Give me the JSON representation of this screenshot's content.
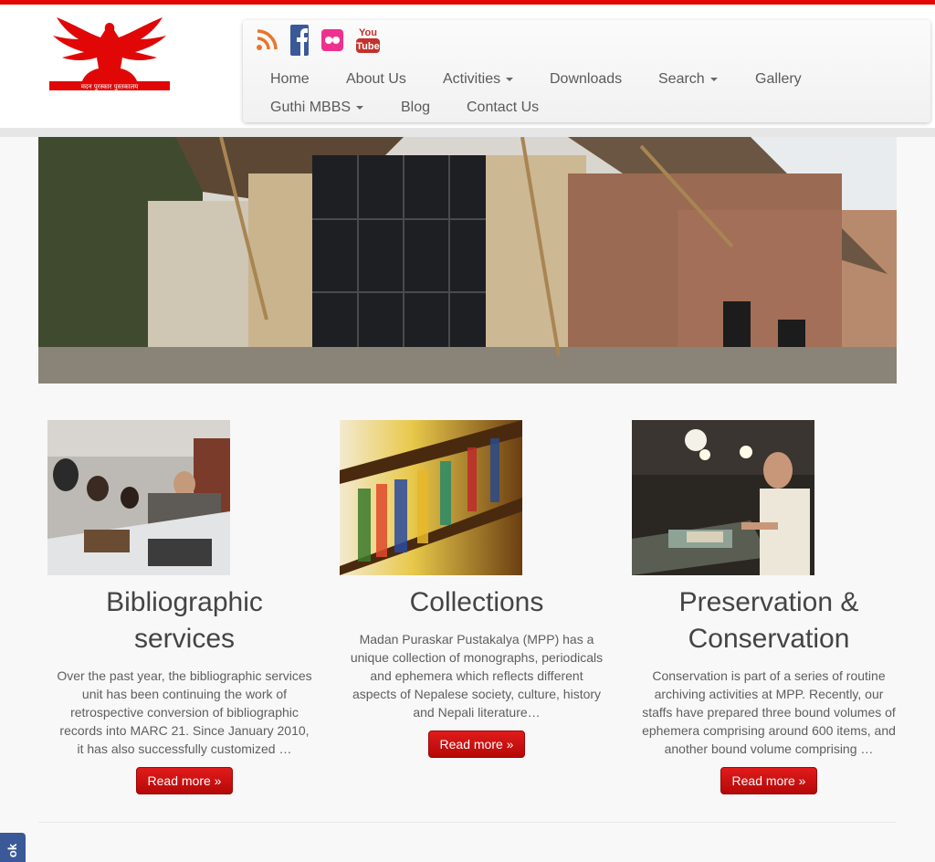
{
  "header": {
    "logo_caption": "मदन पुरस्कार पुस्तकालय"
  },
  "social": [
    "rss-icon",
    "facebook-icon",
    "flickr-icon",
    "youtube-icon"
  ],
  "social_labels": {
    "youtube_top": "You",
    "youtube_bottom": "Tube"
  },
  "nav": {
    "row1": [
      "Home",
      "About Us",
      "Activities",
      "Downloads",
      "Search",
      "Gallery"
    ],
    "row2": [
      "Guthi MBBS",
      "Blog",
      "Contact Us"
    ]
  },
  "cards": [
    {
      "title_line1": "Bibliographic",
      "title_line2": "services",
      "text": [
        "Over the past year, the bibliographic services",
        "unit has been continuing the work of",
        "retrospective conversion of bibliographic",
        "records into MARC 21. Since January 2010,",
        "it has also successfully customized …"
      ],
      "button": "Read more »"
    },
    {
      "title_line1": "Collections",
      "title_line2": "",
      "text": [
        "Madan Puraskar Pustakalya (MPP) has a",
        "unique collection of monographs, periodicals",
        "and ephemera which reflects different",
        "aspects of Nepalese society, culture, history",
        "and Nepali literature…"
      ],
      "button": "Read more »"
    },
    {
      "title_line1": "Preservation &",
      "title_line2": "Conservation",
      "text": [
        "Conservation is part of a series of routine",
        "archiving activities at MPP. Recently, our",
        "staffs have prepared three bound volumes of",
        "ephemera comprising around 600 items, and",
        "another bound volume comprising …"
      ],
      "button": "Read more »"
    }
  ],
  "facebook_tab": "ok",
  "colors": {
    "accent": "#e10707",
    "button": "#c40d0d",
    "facebook": "#3b5998"
  }
}
